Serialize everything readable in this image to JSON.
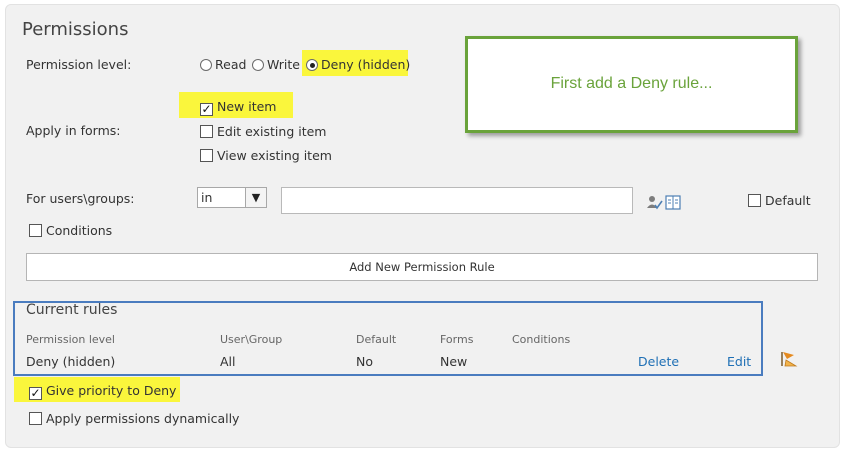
{
  "section_title": "Permissions",
  "permission_level": {
    "label": "Permission level:",
    "options": {
      "read": "Read",
      "write": "Write",
      "deny": "Deny (hidden)"
    },
    "selected": "Deny (hidden)"
  },
  "apply_in_forms": {
    "label": "Apply in forms:",
    "new_item": "New item",
    "edit_existing": "Edit existing item",
    "view_existing": "View existing item"
  },
  "users_groups": {
    "label": "For users\\groups:",
    "operator_value": "in",
    "input_value": "",
    "default_label": "Default"
  },
  "conditions_label": "Conditions",
  "add_rule_button": "Add New Permission Rule",
  "callout_text": "First add a Deny rule...",
  "current_rules": {
    "title": "Current rules",
    "headers": {
      "permission_level": "Permission level",
      "user_group": "User\\Group",
      "default": "Default",
      "forms": "Forms",
      "conditions": "Conditions"
    },
    "rows": [
      {
        "permission_level": "Deny (hidden)",
        "user_group": "All",
        "default": "No",
        "forms": "New",
        "conditions": "",
        "delete_label": "Delete",
        "edit_label": "Edit"
      }
    ]
  },
  "give_priority_label": "Give priority to Deny",
  "apply_dynamic_label": "Apply permissions dynamically",
  "colors": {
    "highlight": "#faf63c",
    "callout_green": "#6aa33b",
    "rules_box_blue": "#4a7cbf",
    "link_blue": "#1e6fb5"
  },
  "icons": [
    "people-picker-check-icon",
    "address-book-icon",
    "priority-flag-icon"
  ]
}
